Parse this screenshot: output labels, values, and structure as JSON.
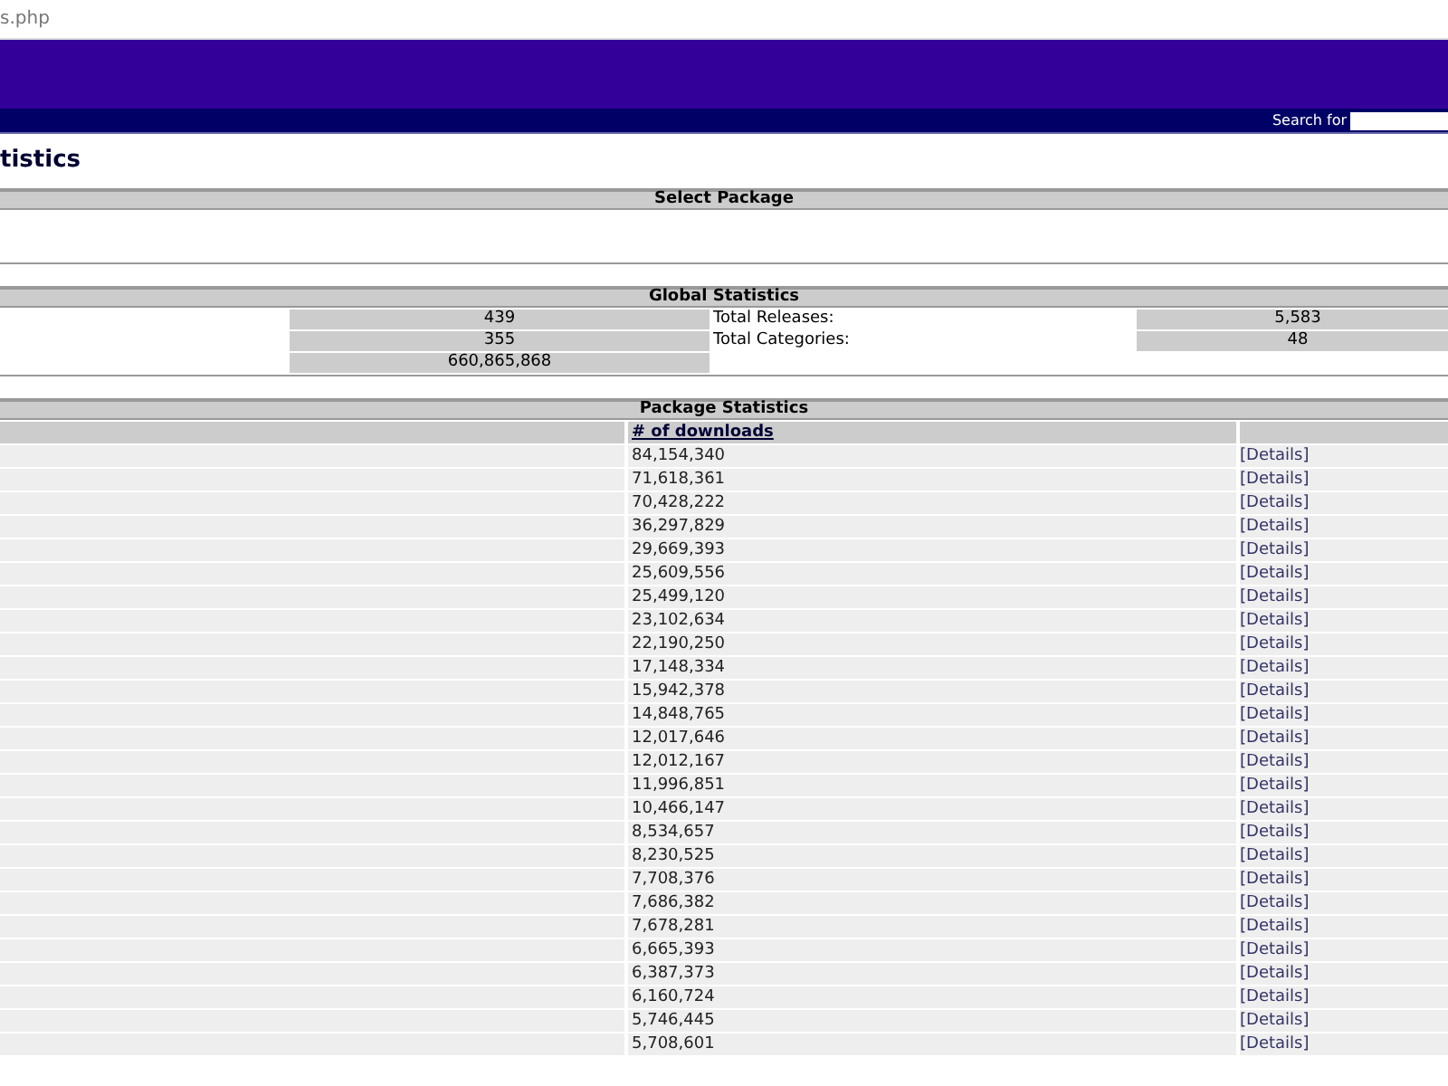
{
  "address_bar": {
    "url": "s.php"
  },
  "search": {
    "label": "Search for"
  },
  "page_title": "tistics",
  "select_package": {
    "title": "Select Package"
  },
  "global_statistics": {
    "title": "Global Statistics",
    "rows": [
      {
        "value": "439",
        "label": "Total Releases:",
        "value_2": "5,583"
      },
      {
        "value": "355",
        "label": "Total Categories:",
        "value_2": "48"
      },
      {
        "value": "660,865,868"
      }
    ]
  },
  "package_statistics": {
    "title": "Package Statistics",
    "columns": [
      "# of downloads"
    ],
    "rows": [
      {
        "downloads": "84,154,340",
        "link": "[Details]"
      },
      {
        "downloads": "71,618,361",
        "link": "[Details]"
      },
      {
        "downloads": "70,428,222",
        "link": "[Details]"
      },
      {
        "downloads": "36,297,829",
        "link": "[Details]"
      },
      {
        "downloads": "29,669,393",
        "link": "[Details]"
      },
      {
        "downloads": "25,609,556",
        "link": "[Details]"
      },
      {
        "downloads": "25,499,120",
        "link": "[Details]"
      },
      {
        "downloads": "23,102,634",
        "link": "[Details]"
      },
      {
        "downloads": "22,190,250",
        "link": "[Details]"
      },
      {
        "downloads": "17,148,334",
        "link": "[Details]"
      },
      {
        "downloads": "15,942,378",
        "link": "[Details]"
      },
      {
        "downloads": "14,848,765",
        "link": "[Details]"
      },
      {
        "downloads": "12,017,646",
        "link": "[Details]"
      },
      {
        "downloads": "12,012,167",
        "link": "[Details]"
      },
      {
        "downloads": "11,996,851",
        "link": "[Details]"
      },
      {
        "downloads": "10,466,147",
        "link": "[Details]"
      },
      {
        "downloads": "8,534,657",
        "link": "[Details]"
      },
      {
        "downloads": "8,230,525",
        "link": "[Details]"
      },
      {
        "downloads": "7,708,376",
        "link": "[Details]"
      },
      {
        "downloads": "7,686,382",
        "link": "[Details]"
      },
      {
        "downloads": "7,678,281",
        "link": "[Details]"
      },
      {
        "downloads": "6,665,393",
        "link": "[Details]"
      },
      {
        "downloads": "6,387,373",
        "link": "[Details]"
      },
      {
        "downloads": "6,160,724",
        "link": "[Details]"
      },
      {
        "downloads": "5,746,445",
        "link": "[Details]"
      },
      {
        "downloads": "5,708,601",
        "link": "[Details]"
      }
    ]
  }
}
